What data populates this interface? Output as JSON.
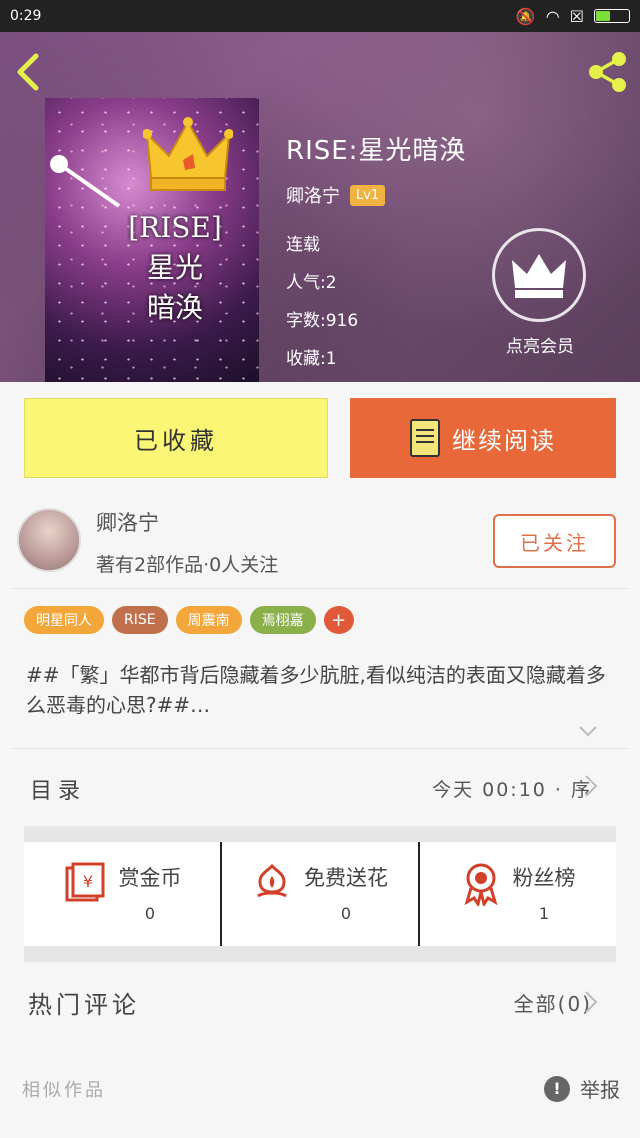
{
  "status_bar": {
    "time": "0:29"
  },
  "header": {
    "book_title": "RISE:星光暗涣",
    "author": "卿洛宁",
    "level_badge": "Lv1",
    "status": "连载",
    "popularity": "人气:2",
    "word_count": "字数:916",
    "collections": "收藏:1",
    "vip_label": "点亮会员",
    "cover_text_line1": "[RISE]",
    "cover_text_line2": "星光",
    "cover_text_line3": "暗涣"
  },
  "actions": {
    "collected_label": "已收藏",
    "read_label": "继续阅读"
  },
  "author_card": {
    "name": "卿洛宁",
    "stats": "著有2部作品·0人关注",
    "follow_label": "已关注"
  },
  "tags": [
    {
      "label": "明星同人",
      "color": "#f3a73b"
    },
    {
      "label": "RISE",
      "color": "#c0704c"
    },
    {
      "label": "周震南",
      "color": "#f3a73b"
    },
    {
      "label": "焉栩嘉",
      "color": "#8ab04a"
    }
  ],
  "tag_more": "+",
  "description": "##「繁」华都市背后隐藏着多少肮脏,看似纯洁的表面又隐藏着多么恶毒的心思?##…",
  "toc": {
    "label": "目录",
    "info": "今天 00:10 · 序"
  },
  "stats": [
    {
      "label": "赏金币",
      "value": "0",
      "icon": "red-envelope-icon"
    },
    {
      "label": "免费送花",
      "value": "0",
      "icon": "flower-icon"
    },
    {
      "label": "粉丝榜",
      "value": "1",
      "icon": "medal-icon"
    }
  ],
  "comments": {
    "title": "热门评论",
    "all_label": "全部(0)"
  },
  "footer": {
    "similar_label": "相似作品",
    "report_label": "举报"
  },
  "colors": {
    "accent_orange": "#e8683a",
    "collected_yellow": "#fbf675",
    "back_yellow": "#e6f04a",
    "icon_red": "#d2402a"
  }
}
